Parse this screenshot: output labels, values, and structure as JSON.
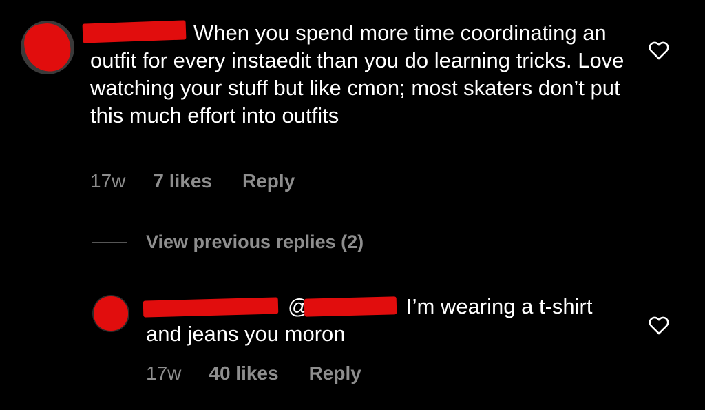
{
  "comment": {
    "text": "When you spend more time coordinating an outfit for every instaedit than you do learning tricks. Love watching your stuff but like cmon; most skaters don’t put this much effort into outfits",
    "time": "17w",
    "likes": "7 likes",
    "reply_label": "Reply"
  },
  "view_replies": {
    "label": "View previous replies (2)"
  },
  "reply": {
    "mention_prefix": "@",
    "text": "I’m wearing a t-shirt and jeans you moron",
    "time": "17w",
    "likes": "40 likes",
    "reply_label": "Reply"
  },
  "icons": {
    "like": "heart-outline-icon"
  },
  "colors": {
    "background": "#000000",
    "text": "#ffffff",
    "meta": "#8e8e8e",
    "redaction": "#e10d0d"
  }
}
